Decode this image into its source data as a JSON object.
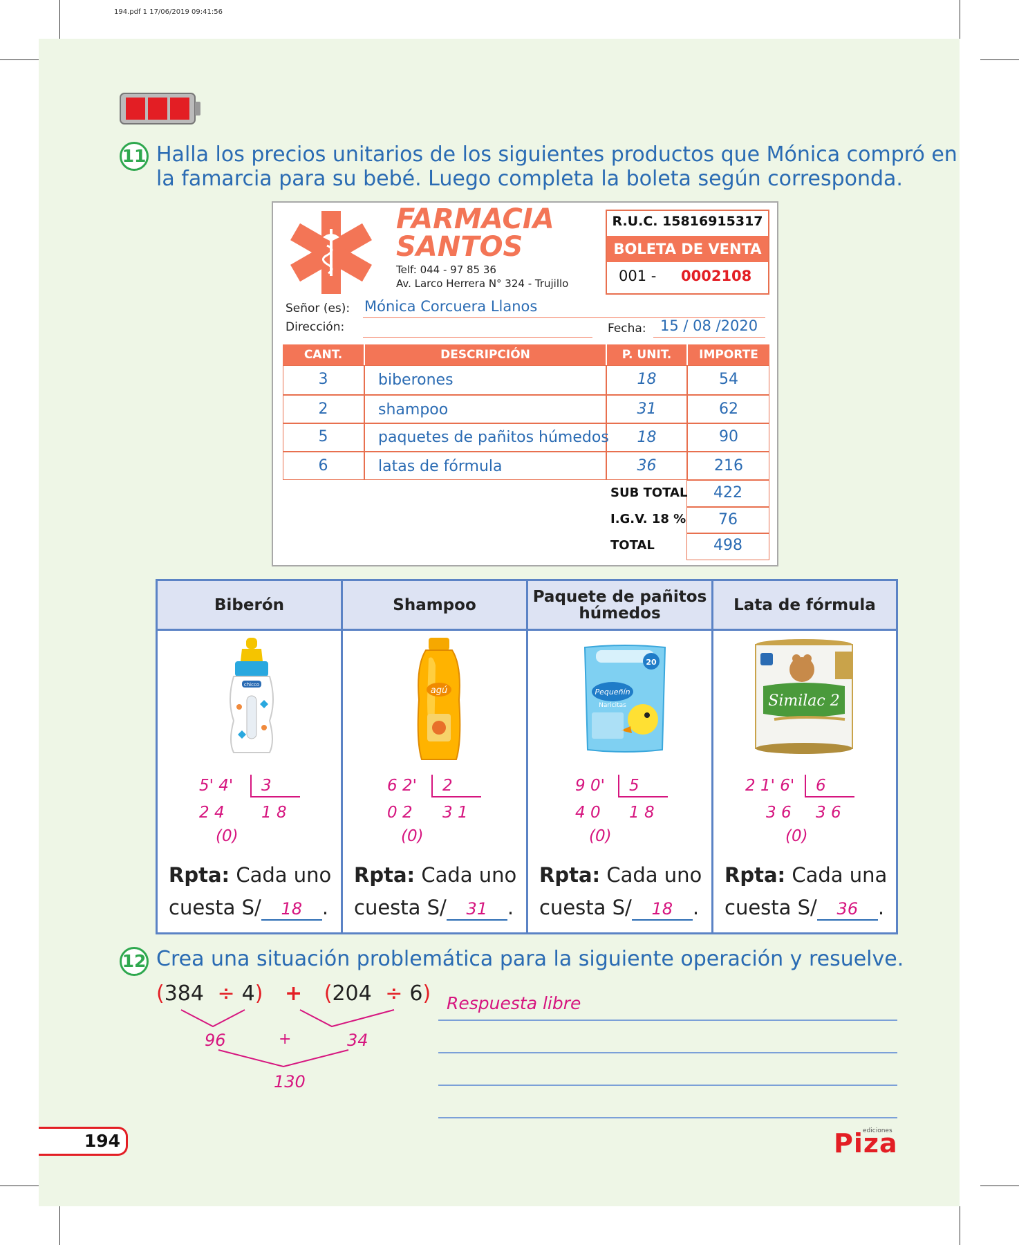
{
  "print_header": "194.pdf  1  17/06/2019  09:41:56",
  "q11": {
    "number": "11",
    "text_line1": "Halla los precios unitarios de los siguientes productos que Mónica compró en",
    "text_line2": "la famarcia para su bebé. Luego completa la boleta según corresponda."
  },
  "receipt": {
    "store_line1": "FARMACIA",
    "store_line2": "SANTOS",
    "phone": "Telf: 044 - 97 85 36",
    "address": "Av. Larco Herrera N° 324 - Trujillo",
    "ruc": "R.U.C. 15816915317",
    "doc_type": "BOLETA DE VENTA",
    "serie": "001 -",
    "number": "0002108",
    "senor_label": "Señor (es):",
    "senor_value": "Mónica Corcuera Llanos",
    "direccion_label": "Dirección:",
    "fecha_label": "Fecha:",
    "fecha_value": "15 / 08 /2020",
    "headers": [
      "CANT.",
      "DESCRIPCIÓN",
      "P. UNIT.",
      "IMPORTE"
    ],
    "rows": [
      {
        "cant": "3",
        "desc": "biberones",
        "punit": "18",
        "importe": "54"
      },
      {
        "cant": "2",
        "desc": "shampoo",
        "punit": "31",
        "importe": "62"
      },
      {
        "cant": "5",
        "desc": "paquetes de pañitos húmedos",
        "punit": "18",
        "importe": "90"
      },
      {
        "cant": "6",
        "desc": "latas de fórmula",
        "punit": "36",
        "importe": "216"
      }
    ],
    "subtotal_label": "SUB TOTAL",
    "subtotal": "422",
    "igv_label": "I.G.V. 18 %",
    "igv": "76",
    "total_label": "TOTAL",
    "total": "498"
  },
  "products": [
    {
      "name": "Biberón",
      "dividend": "5' 4'",
      "divisor": "3",
      "work": "2  4",
      "quotient": "1  8",
      "residue": "(0)",
      "rpta_label": "Rpta:",
      "rpta_text1": "Cada uno",
      "rpta_text2": "cuesta S/",
      "answer": "18",
      "end": "."
    },
    {
      "name": "Shampoo",
      "dividend": "6  2'",
      "divisor": "2",
      "work": "0  2",
      "quotient": "3  1",
      "residue": "(0)",
      "rpta_label": "Rpta:",
      "rpta_text1": "Cada uno",
      "rpta_text2": "cuesta S/",
      "answer": "31",
      "end": "."
    },
    {
      "name": "Paquete de pañitos húmedos",
      "dividend": "9  0'",
      "divisor": "5",
      "work": "4  0",
      "quotient": "1  8",
      "residue": "(0)",
      "rpta_label": "Rpta:",
      "rpta_text1": "Cada uno",
      "rpta_text2": "cuesta S/",
      "answer": "18",
      "end": "."
    },
    {
      "name": "Lata de fórmula",
      "dividend": "2  1' 6'",
      "divisor": "6",
      "work": "3  6",
      "quotient": "3  6",
      "residue": "(0)",
      "rpta_label": "Rpta:",
      "rpta_text1": "Cada una",
      "rpta_text2": "cuesta S/",
      "answer": "36",
      "end": "."
    }
  ],
  "product_labels": {
    "bottle_brand": "chicco",
    "shampoo_brand": "agú",
    "wipes_brand": "Pequeñín",
    "wipes_sub": "Naricitas",
    "wipes_count": "20",
    "formula_brand": "Similac 2"
  },
  "q12": {
    "number": "12",
    "text": "Crea una situación problemática para la siguiente operación y resuelve.",
    "op_open1": "(",
    "op_a": "384",
    "op_div1": "÷",
    "op_b": "4",
    "op_close1": ")",
    "op_plus": "+",
    "op_open2": "(",
    "op_c": "204",
    "op_div2": "÷",
    "op_d": "6",
    "op_close2": ")",
    "r1": "96",
    "plus2": "+",
    "r2": "34",
    "result": "130",
    "answer_text": "Respuesta libre"
  },
  "footer": {
    "page": "194",
    "publisher_small": "ediciones",
    "publisher": "Piza"
  }
}
